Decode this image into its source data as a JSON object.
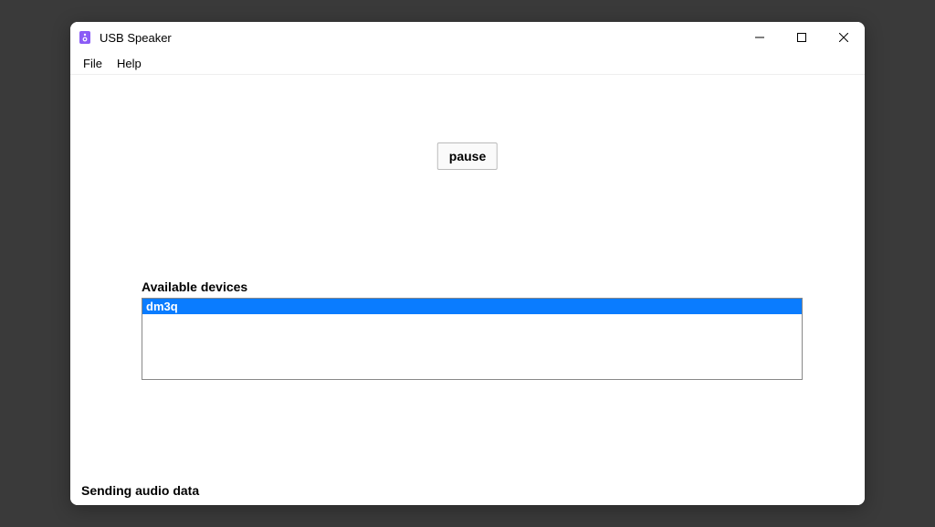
{
  "window": {
    "title": "USB Speaker",
    "icon_name": "speaker-icon"
  },
  "menubar": {
    "items": [
      "File",
      "Help"
    ]
  },
  "main": {
    "pause_button_label": "pause",
    "devices_label": "Available devices",
    "devices": [
      {
        "name": "dm3q",
        "selected": true
      }
    ],
    "status_text": "Sending audio data"
  }
}
